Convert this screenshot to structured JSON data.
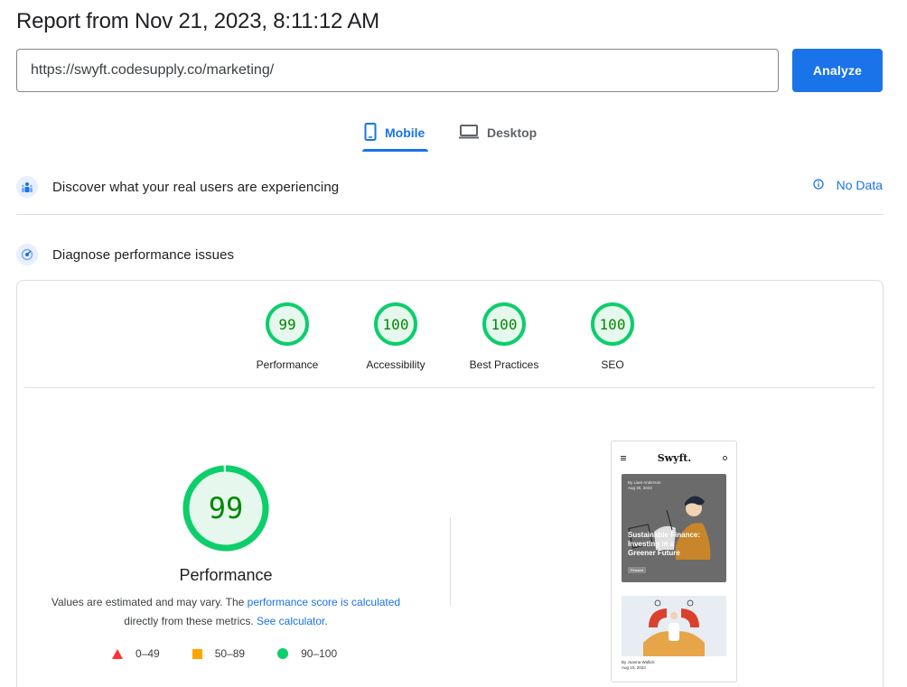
{
  "header": {
    "title": "Report from Nov 21, 2023, 8:11:12 AM"
  },
  "url_bar": {
    "value": "https://swyft.codesupply.co/marketing/",
    "button_label": "Analyze"
  },
  "tabs": [
    {
      "label": "Mobile",
      "active": true,
      "icon": "smartphone-icon"
    },
    {
      "label": "Desktop",
      "active": false,
      "icon": "laptop-icon"
    }
  ],
  "field_data": {
    "title": "Discover what your real users are experiencing",
    "status_label": "No Data",
    "status_icon": "info-icon"
  },
  "lab_data": {
    "title": "Diagnose performance issues"
  },
  "categories": [
    {
      "label": "Performance",
      "score": "99"
    },
    {
      "label": "Accessibility",
      "score": "100"
    },
    {
      "label": "Best Practices",
      "score": "100"
    },
    {
      "label": "SEO",
      "score": "100"
    }
  ],
  "performance": {
    "score": "99",
    "score_fraction": 0.99,
    "title": "Performance",
    "note_prefix": "Values are estimated and may vary. The ",
    "note_link": "performance score is calculated",
    "note_mid": " directly from these metrics. ",
    "note_link2": "See calculator",
    "note_end": "."
  },
  "legend": [
    {
      "label": "0–49",
      "shape": "triangle",
      "color": "#ff3333"
    },
    {
      "label": "50–89",
      "shape": "square",
      "color": "#ffa400"
    },
    {
      "label": "90–100",
      "shape": "circle",
      "color": "#0cce6b"
    }
  ],
  "screenshot": {
    "logo": "Swyft.",
    "byline": "By Liam Anderson",
    "date": "Aug 30, 2023",
    "headline": "Sustainable Finance: Investing in a Greener Future",
    "tag": "Finance",
    "byline2": "By Joanna Wallick",
    "date2": "Aug 10, 2023"
  },
  "colors": {
    "accent": "#1a73e8",
    "pass": "#0cce6b",
    "pass_text": "#008800",
    "average": "#ffa400",
    "fail": "#ff3333"
  }
}
